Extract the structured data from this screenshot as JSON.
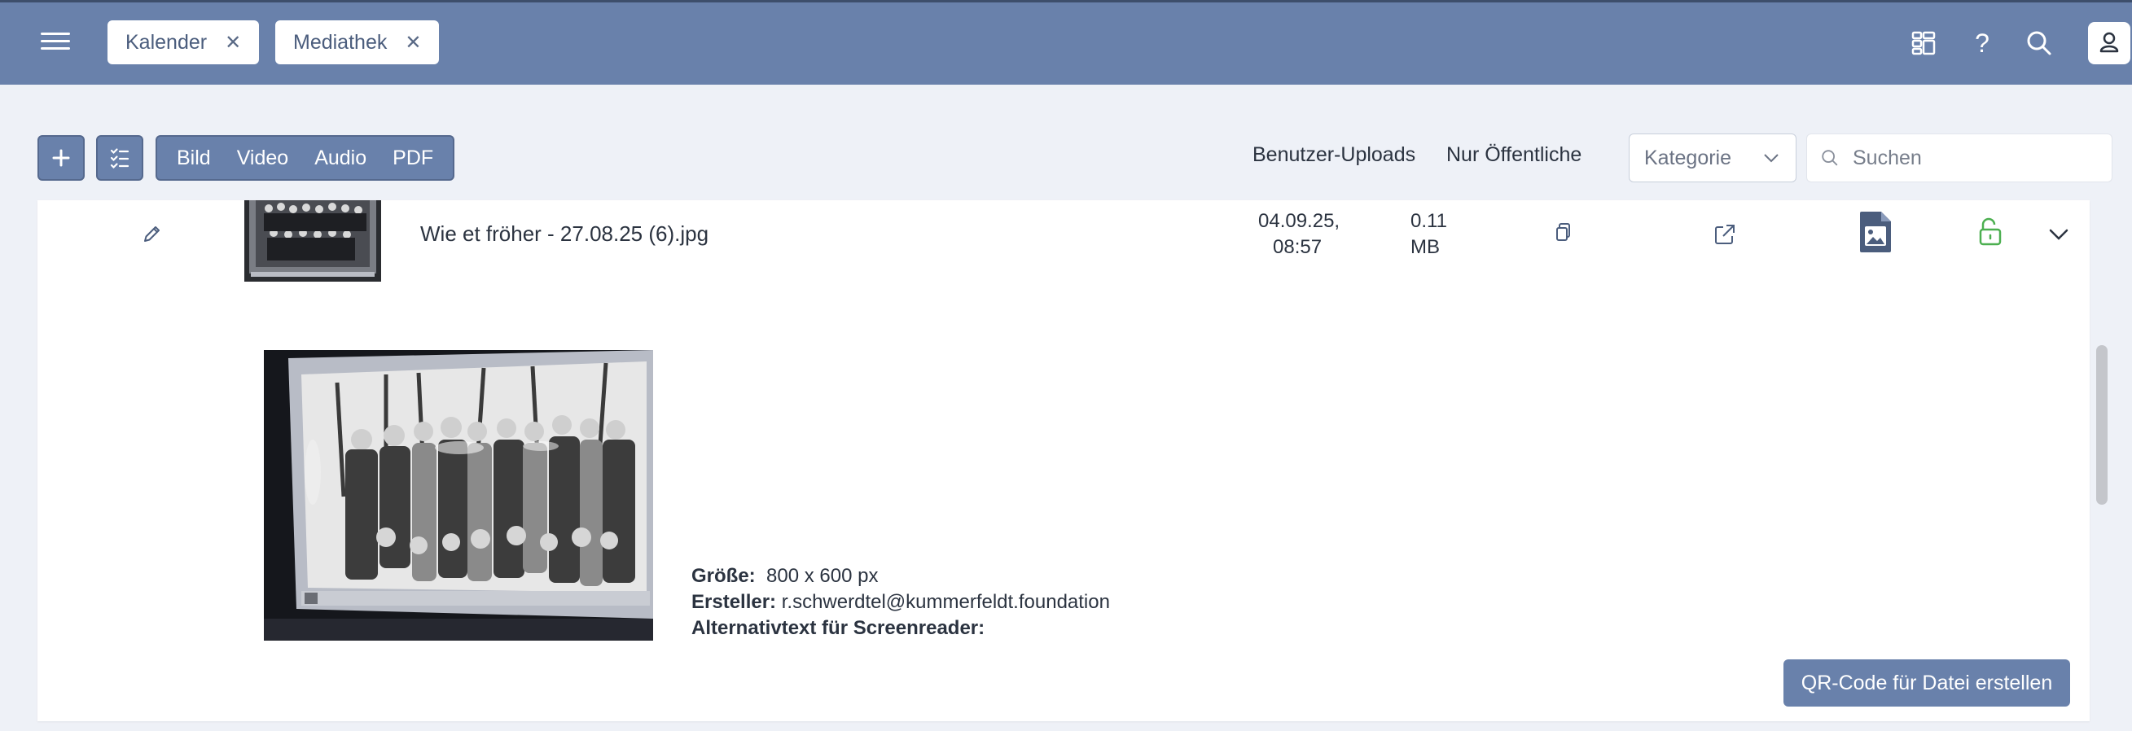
{
  "header": {
    "tabs": [
      {
        "label": "Kalender",
        "close": "✕"
      },
      {
        "label": "Mediathek",
        "close": "✕"
      }
    ],
    "icons": [
      "hamburger-icon",
      "grid-layout-icon",
      "help-icon",
      "search-icon",
      "user-icon"
    ],
    "help_glyph": "?"
  },
  "toolbar": {
    "add_icon": "plus-icon",
    "select_icon": "checklist-icon",
    "segments": [
      "Bild",
      "Video",
      "Audio",
      "PDF"
    ],
    "filters": [
      "Benutzer-Uploads",
      "Nur Öffentliche"
    ],
    "category": {
      "label": "Kategorie"
    },
    "search": {
      "placeholder": "Suchen",
      "value": ""
    }
  },
  "file": {
    "name": "Wie et fröher - 27.08.25 (6).jpg",
    "date_line1": "04.09.25,",
    "date_line2": "08:57",
    "size_line1": "0.11",
    "size_line2": "MB",
    "details": {
      "size_label": "Größe:",
      "size_value": "800 x 600 px",
      "creator_label": "Ersteller:",
      "creator_value": "r.schwerdtel@kummerfeldt.foundation",
      "alt_label": "Alternativtext für Screenreader:",
      "alt_value": ""
    },
    "qr_button": "QR-Code für Datei erstellen"
  },
  "colors": {
    "primary": "#6981ab",
    "background": "#eef1f7",
    "public_green": "#4caf50",
    "text": "#2b3340"
  }
}
